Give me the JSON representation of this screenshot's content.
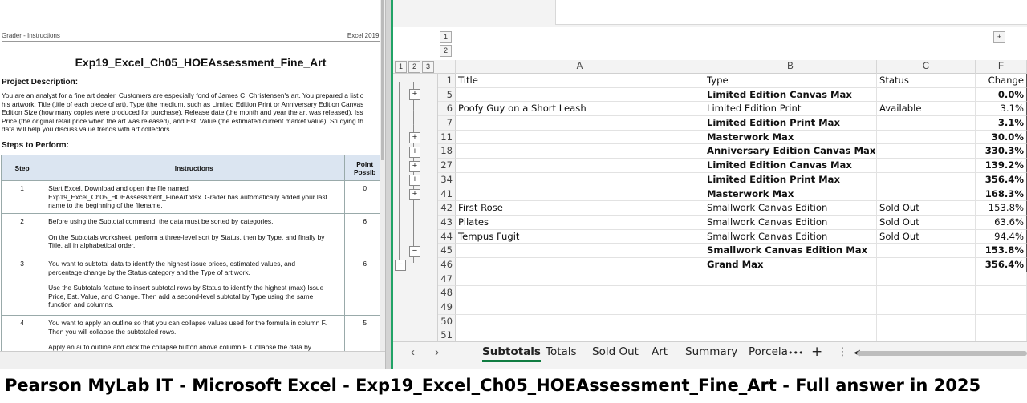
{
  "pdf": {
    "header_left": "Grader - Instructions",
    "header_right": "Excel 2019 P",
    "title": "Exp19_Excel_Ch05_HOEAssessment_Fine_Art",
    "project_heading": "Project Description:",
    "project_text": "You are an analyst for a fine art dealer. Customers are especially fond of James C. Christensen's art. You prepared a list o\nhis artwork: Title (title of each piece of art), Type (the medium, such as Limited Edition Print or Anniversary Edition Canvas\nEdition Size (how many copies were produced for purchase), Release date (the month and year the art was released), Iss\nPrice (the original retail price when the art was released), and Est. Value (the estimated current market value). Studying th\ndata will help you discuss value trends with art collectors",
    "steps_heading": "Steps to Perform:",
    "table_headers": [
      "Step",
      "Instructions",
      "Point\nPossib"
    ],
    "steps": [
      {
        "step": "1",
        "text": [
          "Start Excel. Download and open the file named\nExp19_Excel_Ch05_HOEAssessment_FineArt.xlsx. Grader has automatically added your last\nname to the beginning of the filename."
        ],
        "points": "0"
      },
      {
        "step": "2",
        "text": [
          "Before using the Subtotal command, the data must be sorted by categories.",
          "On the Subtotals worksheet, perform a three-level sort by Status, then by Type, and finally by\nTitle, all in alphabetical order."
        ],
        "points": "6"
      },
      {
        "step": "3",
        "text": [
          "You want to subtotal data to identify the highest issue prices, estimated values, and\npercentage change by the Status category and the Type of art work.",
          "Use the Subtotals feature to insert subtotal rows by Status to identify the highest (max) Issue\nPrice,  Est. Value, and Change. Then add a second-level subtotal by Type using the same\nfunction and columns."
        ],
        "points": "6"
      },
      {
        "step": "4",
        "text": [
          "You want to apply an outline so that you can collapse values used for the formula in column F.\nThen you will collapse the subtotaled rows.",
          "Apply an auto outline and click the collapse button above column F. Collapse the data by"
        ],
        "points": "5"
      }
    ]
  },
  "excel": {
    "column_group_levels": [
      "1",
      "2"
    ],
    "column_group_button": "+",
    "outline_levels": [
      "1",
      "2",
      "3"
    ],
    "columns": [
      "A",
      "B",
      "C",
      "F"
    ],
    "rows": [
      {
        "num": "1",
        "title": "Title",
        "type": "Type",
        "status": "Status",
        "change": "Change",
        "bold": false
      },
      {
        "num": "5",
        "title": "",
        "type": "Limited Edition Canvas Max",
        "status": "",
        "change": "0.0%",
        "bold": true
      },
      {
        "num": "6",
        "title": "Poofy Guy on a Short Leash",
        "type": "Limited Edition Print",
        "status": "Available",
        "change": "3.1%",
        "bold": false
      },
      {
        "num": "7",
        "title": "",
        "type": "Limited Edition Print Max",
        "status": "",
        "change": "3.1%",
        "bold": true
      },
      {
        "num": "11",
        "title": "",
        "type": "Masterwork Max",
        "status": "",
        "change": "30.0%",
        "bold": true
      },
      {
        "num": "18",
        "title": "",
        "type": "Anniversary Edition Canvas Max",
        "status": "",
        "change": "330.3%",
        "bold": true
      },
      {
        "num": "27",
        "title": "",
        "type": "Limited Edition Canvas Max",
        "status": "",
        "change": "139.2%",
        "bold": true
      },
      {
        "num": "34",
        "title": "",
        "type": "Limited Edition Print Max",
        "status": "",
        "change": "356.4%",
        "bold": true
      },
      {
        "num": "41",
        "title": "",
        "type": "Masterwork Max",
        "status": "",
        "change": "168.3%",
        "bold": true
      },
      {
        "num": "42",
        "title": "First Rose",
        "type": "Smallwork Canvas Edition",
        "status": "Sold Out",
        "change": "153.8%",
        "bold": false
      },
      {
        "num": "43",
        "title": "Pilates",
        "type": "Smallwork Canvas Edition",
        "status": "Sold Out",
        "change": "63.6%",
        "bold": false
      },
      {
        "num": "44",
        "title": "Tempus Fugit",
        "type": "Smallwork Canvas Edition",
        "status": "Sold Out",
        "change": "94.4%",
        "bold": false
      },
      {
        "num": "45",
        "title": "",
        "type": "Smallwork Canvas Edition Max",
        "status": "",
        "change": "153.8%",
        "bold": true
      },
      {
        "num": "46",
        "title": "",
        "type": "Grand Max",
        "status": "",
        "change": "356.4%",
        "bold": true
      },
      {
        "num": "47",
        "title": "",
        "type": "",
        "status": "",
        "change": "",
        "bold": false
      },
      {
        "num": "48",
        "title": "",
        "type": "",
        "status": "",
        "change": "",
        "bold": false
      },
      {
        "num": "49",
        "title": "",
        "type": "",
        "status": "",
        "change": "",
        "bold": false
      },
      {
        "num": "50",
        "title": "",
        "type": "",
        "status": "",
        "change": "",
        "bold": false
      },
      {
        "num": "51",
        "title": "",
        "type": "",
        "status": "",
        "change": "",
        "bold": false
      }
    ],
    "sheet_tabs": [
      "Subtotals",
      "Totals",
      "Sold Out",
      "Art",
      "Summary",
      "Porcela"
    ],
    "active_tab": "Subtotals",
    "tab_controls": {
      "prev": "‹",
      "next": "›",
      "more": "•••",
      "add": "+",
      "options": "⋮"
    }
  },
  "caption": "Pearson MyLab IT - Microsoft Excel - Exp19_Excel_Ch05_HOEAssessment_Fine_Art - Full answer in 2025",
  "colors": {
    "excel_green": "#21a366",
    "tab_underline": "#107c41",
    "table_header_bg": "#dbe5f1"
  }
}
